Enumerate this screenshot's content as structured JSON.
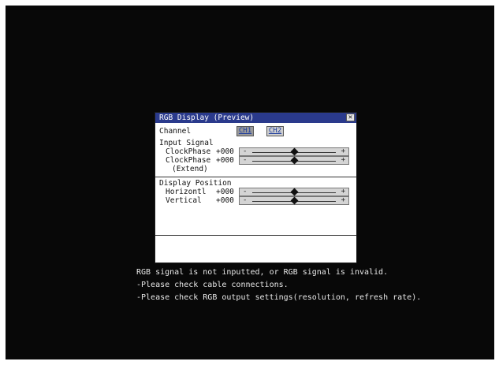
{
  "dialog": {
    "title": "RGB Display (Preview)",
    "close_glyph": "✕",
    "channel_label": "Channel",
    "channels": [
      {
        "label": "CH1",
        "selected": true
      },
      {
        "label": "CH2",
        "selected": false
      }
    ],
    "input_signal": {
      "heading": "Input Signal",
      "rows": [
        {
          "label": "ClockPhase",
          "value": "+000",
          "minus": "-",
          "plus": "+",
          "level_percent": 50
        },
        {
          "label": "ClockPhase",
          "value": "+000",
          "minus": "-",
          "plus": "+",
          "level_percent": 50
        }
      ],
      "extend_note": "(Extend)"
    },
    "display_position": {
      "heading": "Display Position",
      "rows": [
        {
          "label": "Horizontl",
          "value": "+000",
          "minus": "-",
          "plus": "+",
          "level_percent": 50
        },
        {
          "label": "Vertical",
          "value": "+000",
          "minus": "-",
          "plus": "+",
          "level_percent": 50
        }
      ]
    }
  },
  "message": {
    "line1": "RGB signal is not inputted, or RGB signal is invalid.",
    "line2": "-Please check cable connections.",
    "line3": "-Please check RGB output settings(resolution, refresh rate)."
  },
  "colors": {
    "screen": "#080808",
    "titlebar": "#2a3a8c",
    "dialog": "#ffffff",
    "slider": "#d4d4d4"
  }
}
